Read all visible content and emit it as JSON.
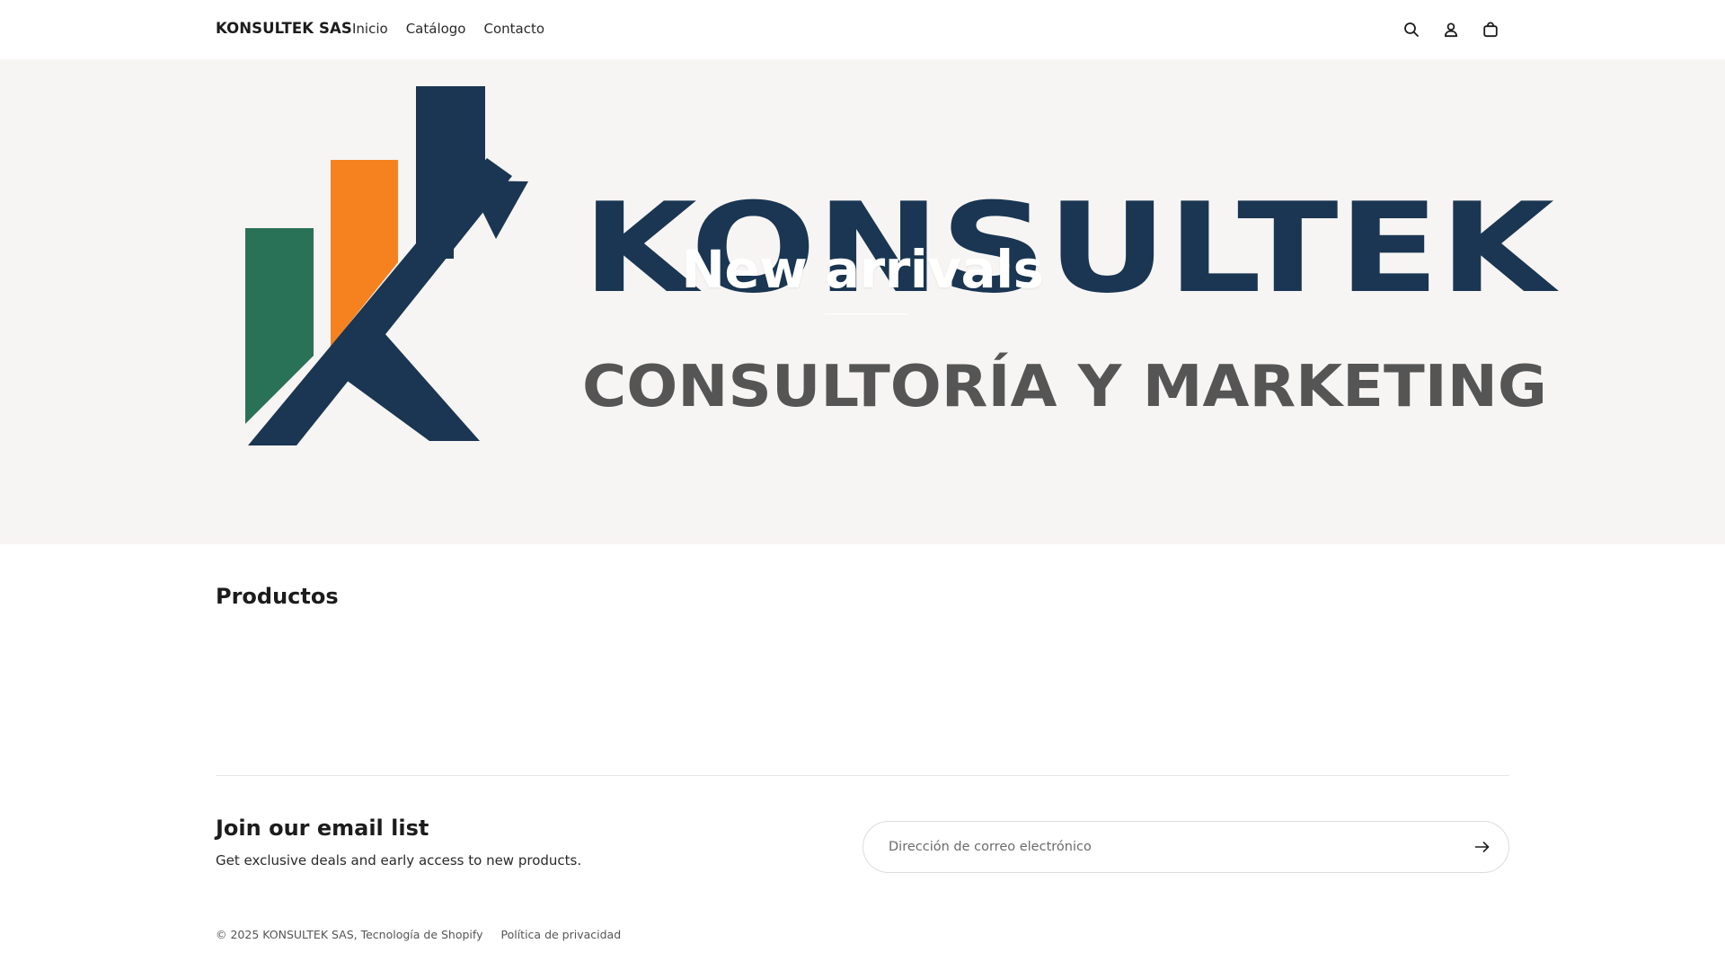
{
  "header": {
    "brand": "KONSULTEK SAS",
    "nav": [
      {
        "label": "Inicio"
      },
      {
        "label": "Catálogo"
      },
      {
        "label": "Contacto"
      }
    ],
    "icons": [
      "search-icon",
      "account-icon",
      "cart-icon"
    ]
  },
  "hero": {
    "logo_wordmark": "KONSULTEK",
    "logo_tagline": "CONSULTORÍA Y MARKETING",
    "title": "New arrivals",
    "colors": {
      "navy": "#1a3652",
      "orange": "#f5821f",
      "green": "#2a7257",
      "grey": "#555555"
    }
  },
  "products": {
    "title": "Productos"
  },
  "newsletter": {
    "title": "Join our email list",
    "subtitle": "Get exclusive deals and early access to new products.",
    "placeholder": "Dirección de correo electrónico"
  },
  "footer": {
    "copyright": "© 2025 KONSULTEK SAS, Tecnología de Shopify",
    "privacy": "Política de privacidad"
  }
}
